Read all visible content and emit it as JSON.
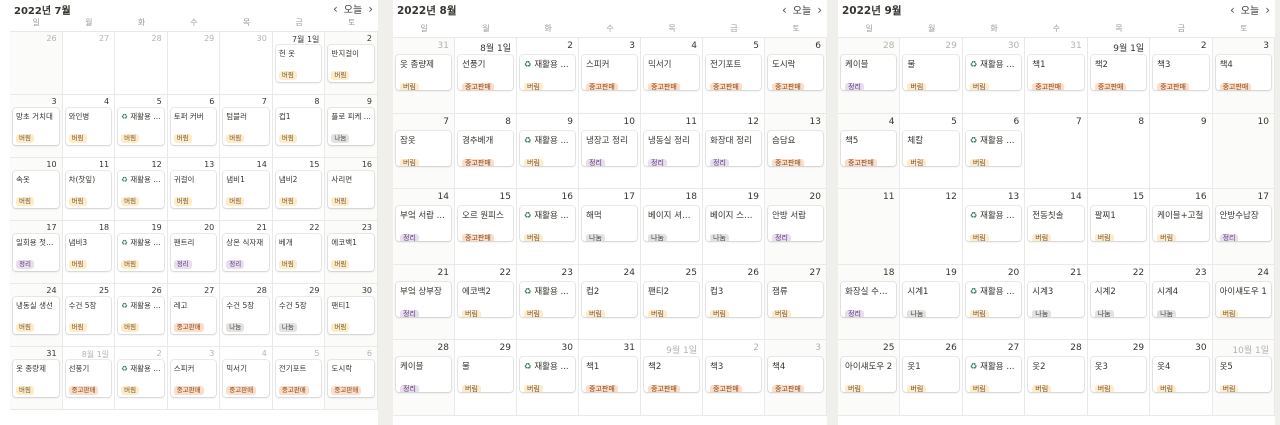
{
  "weekdays": [
    "일",
    "월",
    "화",
    "수",
    "목",
    "금",
    "토"
  ],
  "nav": {
    "prev": "‹",
    "today": "오늘",
    "next": "›"
  },
  "tags": {
    "b": "버림",
    "s": "중고판매",
    "j": "정리",
    "n": "나눔"
  },
  "calendars": [
    {
      "title": "2022년 7월",
      "cells": [
        {
          "d": "26",
          "dim": true
        },
        {
          "d": "27",
          "dim": true
        },
        {
          "d": "28",
          "dim": true
        },
        {
          "d": "29",
          "dim": true
        },
        {
          "d": "30",
          "dim": true
        },
        {
          "d": "7월 1일",
          "c": {
            "t": "헌 옷",
            "g": "b"
          }
        },
        {
          "d": "2",
          "c": {
            "t": "반지걸이",
            "g": "b"
          }
        },
        {
          "d": "3",
          "c": {
            "t": "망초 거치대",
            "g": "b"
          }
        },
        {
          "d": "4",
          "c": {
            "t": "와인병",
            "g": "b"
          }
        },
        {
          "d": "5",
          "c": {
            "t": "재활용 ...",
            "g": "b",
            "r": true
          }
        },
        {
          "d": "6",
          "c": {
            "t": "토퍼 커버",
            "g": "b"
          }
        },
        {
          "d": "7",
          "c": {
            "t": "텀블러",
            "g": "b"
          }
        },
        {
          "d": "8",
          "c": {
            "t": "컵1",
            "g": "b"
          }
        },
        {
          "d": "9",
          "c": {
            "t": "플로 피케 ...",
            "g": "n"
          }
        },
        {
          "d": "10",
          "c": {
            "t": "속옷",
            "g": "b"
          }
        },
        {
          "d": "11",
          "c": {
            "t": "차(찻잎)",
            "g": "b"
          }
        },
        {
          "d": "12",
          "c": {
            "t": "재활용 ...",
            "g": "b",
            "r": true
          }
        },
        {
          "d": "13",
          "c": {
            "t": "귀걸이",
            "g": "b"
          }
        },
        {
          "d": "14",
          "c": {
            "t": "냄비1",
            "g": "b"
          }
        },
        {
          "d": "15",
          "c": {
            "t": "냄비2",
            "g": "b"
          }
        },
        {
          "d": "16",
          "c": {
            "t": "사리면",
            "g": "b"
          }
        },
        {
          "d": "17",
          "c": {
            "t": "일회용 젓가락",
            "g": "j"
          }
        },
        {
          "d": "18",
          "c": {
            "t": "냄비3",
            "g": "b"
          }
        },
        {
          "d": "19",
          "c": {
            "t": "재활용 ...",
            "g": "b",
            "r": true
          }
        },
        {
          "d": "20",
          "c": {
            "t": "팬트리",
            "g": "j"
          }
        },
        {
          "d": "21",
          "c": {
            "t": "상온 식자재",
            "g": "j"
          }
        },
        {
          "d": "22",
          "c": {
            "t": "베개",
            "g": "b"
          }
        },
        {
          "d": "23",
          "c": {
            "t": "에코백1",
            "g": "b"
          }
        },
        {
          "d": "24",
          "c": {
            "t": "냉동실 생선",
            "g": "b"
          }
        },
        {
          "d": "25",
          "c": {
            "t": "수건 5장",
            "g": "b"
          }
        },
        {
          "d": "26",
          "c": {
            "t": "재활용 ...",
            "g": "b",
            "r": true
          }
        },
        {
          "d": "27",
          "c": {
            "t": "레고",
            "g": "s"
          }
        },
        {
          "d": "28",
          "c": {
            "t": "수건 5장",
            "g": "n"
          }
        },
        {
          "d": "29",
          "c": {
            "t": "수건 5장",
            "g": "n"
          }
        },
        {
          "d": "30",
          "c": {
            "t": "팬티1",
            "g": "b"
          }
        },
        {
          "d": "31",
          "c": {
            "t": "옷 종량제",
            "g": "b"
          }
        },
        {
          "d": "8월 1일",
          "dim": true,
          "c": {
            "t": "선풍기",
            "g": "s"
          }
        },
        {
          "d": "2",
          "dim": true,
          "c": {
            "t": "재활용 ...",
            "g": "b",
            "r": true
          }
        },
        {
          "d": "3",
          "dim": true,
          "c": {
            "t": "스피커",
            "g": "s"
          }
        },
        {
          "d": "4",
          "dim": true,
          "c": {
            "t": "믹서기",
            "g": "s"
          }
        },
        {
          "d": "5",
          "dim": true,
          "c": {
            "t": "전기포트",
            "g": "s"
          }
        },
        {
          "d": "6",
          "dim": true,
          "c": {
            "t": "도시락",
            "g": "s"
          }
        }
      ]
    },
    {
      "title": "2022년 8월",
      "cells": [
        {
          "d": "31",
          "dim": true,
          "c": {
            "t": "옷 종량제",
            "g": "b"
          }
        },
        {
          "d": "8월 1일",
          "c": {
            "t": "선풍기",
            "g": "s"
          }
        },
        {
          "d": "2",
          "c": {
            "t": "재활용 ...",
            "g": "b",
            "r": true
          }
        },
        {
          "d": "3",
          "c": {
            "t": "스피커",
            "g": "s"
          }
        },
        {
          "d": "4",
          "c": {
            "t": "믹서기",
            "g": "s"
          }
        },
        {
          "d": "5",
          "c": {
            "t": "전기포트",
            "g": "s"
          }
        },
        {
          "d": "6",
          "c": {
            "t": "도시락",
            "g": "s"
          }
        },
        {
          "d": "7",
          "c": {
            "t": "잠옷",
            "g": "b"
          }
        },
        {
          "d": "8",
          "c": {
            "t": "경추베개",
            "g": "s"
          }
        },
        {
          "d": "9",
          "c": {
            "t": "재활용 ...",
            "g": "b",
            "r": true
          }
        },
        {
          "d": "10",
          "c": {
            "t": "냉장고 정리",
            "g": "j"
          }
        },
        {
          "d": "11",
          "c": {
            "t": "냉동실 정리",
            "g": "j"
          }
        },
        {
          "d": "12",
          "c": {
            "t": "화장대 정리",
            "g": "j"
          }
        },
        {
          "d": "13",
          "c": {
            "t": "슴담요",
            "g": "s"
          }
        },
        {
          "d": "14",
          "c": {
            "t": "부엌 서랍 ...",
            "g": "j"
          }
        },
        {
          "d": "15",
          "c": {
            "t": "오르 원피스",
            "g": "s"
          }
        },
        {
          "d": "16",
          "c": {
            "t": "재활용 ...",
            "g": "b",
            "r": true
          }
        },
        {
          "d": "17",
          "c": {
            "t": "해먹",
            "g": "n"
          }
        },
        {
          "d": "18",
          "c": {
            "t": "베이지 셔틴...",
            "g": "n"
          }
        },
        {
          "d": "19",
          "c": {
            "t": "베이지 스커트",
            "g": "n"
          }
        },
        {
          "d": "20",
          "c": {
            "t": "안방 서랍",
            "g": "j"
          }
        },
        {
          "d": "21",
          "c": {
            "t": "부엌 상부장",
            "g": "j"
          }
        },
        {
          "d": "22",
          "c": {
            "t": "에코백2",
            "g": "b"
          }
        },
        {
          "d": "23",
          "c": {
            "t": "재활용 ...",
            "g": "b",
            "r": true
          }
        },
        {
          "d": "24",
          "c": {
            "t": "컵2",
            "g": "b"
          }
        },
        {
          "d": "25",
          "c": {
            "t": "팬티2",
            "g": "b"
          }
        },
        {
          "d": "26",
          "c": {
            "t": "컵3",
            "g": "b"
          }
        },
        {
          "d": "27",
          "c": {
            "t": "잼류",
            "g": "b"
          }
        },
        {
          "d": "28",
          "c": {
            "t": "케이블",
            "g": "j"
          }
        },
        {
          "d": "29",
          "c": {
            "t": "물",
            "g": "b"
          }
        },
        {
          "d": "30",
          "c": {
            "t": "재활용 ...",
            "g": "b",
            "r": true
          }
        },
        {
          "d": "31",
          "c": {
            "t": "책1",
            "g": "s"
          }
        },
        {
          "d": "9월 1일",
          "dim": true,
          "c": {
            "t": "책2",
            "g": "s"
          }
        },
        {
          "d": "2",
          "dim": true,
          "c": {
            "t": "책3",
            "g": "s"
          }
        },
        {
          "d": "3",
          "dim": true,
          "c": {
            "t": "책4",
            "g": "s"
          }
        }
      ]
    },
    {
      "title": "2022년 9월",
      "cells": [
        {
          "d": "28",
          "dim": true,
          "c": {
            "t": "케이블",
            "g": "j"
          }
        },
        {
          "d": "29",
          "dim": true,
          "c": {
            "t": "물",
            "g": "b"
          }
        },
        {
          "d": "30",
          "dim": true,
          "c": {
            "t": "재활용 ...",
            "g": "b",
            "r": true
          }
        },
        {
          "d": "31",
          "dim": true,
          "c": {
            "t": "책1",
            "g": "s"
          }
        },
        {
          "d": "9월 1일",
          "c": {
            "t": "책2",
            "g": "s"
          }
        },
        {
          "d": "2",
          "c": {
            "t": "책3",
            "g": "s"
          }
        },
        {
          "d": "3",
          "c": {
            "t": "책4",
            "g": "s"
          }
        },
        {
          "d": "4",
          "c": {
            "t": "책5",
            "g": "s"
          }
        },
        {
          "d": "5",
          "c": {
            "t": "체칼",
            "g": "b"
          }
        },
        {
          "d": "6",
          "c": {
            "t": "재활용 ...",
            "g": "b",
            "r": true
          }
        },
        {
          "d": "7"
        },
        {
          "d": "8"
        },
        {
          "d": "9"
        },
        {
          "d": "10"
        },
        {
          "d": "11"
        },
        {
          "d": "12"
        },
        {
          "d": "13",
          "c": {
            "t": "재활용 ...",
            "g": "b",
            "r": true
          }
        },
        {
          "d": "14",
          "c": {
            "t": "전동칫솔",
            "g": "b"
          }
        },
        {
          "d": "15",
          "c": {
            "t": "팔찌1",
            "g": "b"
          }
        },
        {
          "d": "16",
          "c": {
            "t": "케이블+고철",
            "g": "b"
          }
        },
        {
          "d": "17",
          "c": {
            "t": "안방수납장",
            "g": "j"
          }
        },
        {
          "d": "18",
          "c": {
            "t": "화장실 수납장",
            "g": "j"
          }
        },
        {
          "d": "19",
          "c": {
            "t": "시계1",
            "g": "n"
          }
        },
        {
          "d": "20",
          "c": {
            "t": "재활용 ...",
            "g": "b",
            "r": true
          }
        },
        {
          "d": "21",
          "c": {
            "t": "시계3",
            "g": "n"
          }
        },
        {
          "d": "22",
          "c": {
            "t": "시계2",
            "g": "n"
          }
        },
        {
          "d": "23",
          "c": {
            "t": "시계4",
            "g": "n"
          }
        },
        {
          "d": "24",
          "c": {
            "t": "아이섀도우 1",
            "g": "b"
          }
        },
        {
          "d": "25",
          "c": {
            "t": "아이섀도우 2",
            "g": "b"
          }
        },
        {
          "d": "26",
          "c": {
            "t": "옷1",
            "g": "b"
          }
        },
        {
          "d": "27",
          "c": {
            "t": "재활용 ...",
            "g": "b",
            "r": true
          }
        },
        {
          "d": "28",
          "c": {
            "t": "옷2",
            "g": "b"
          }
        },
        {
          "d": "29",
          "c": {
            "t": "옷3",
            "g": "b"
          }
        },
        {
          "d": "30",
          "c": {
            "t": "옷4",
            "g": "b"
          }
        },
        {
          "d": "10월 1일",
          "dim": true,
          "c": {
            "t": "옷5",
            "g": "b"
          }
        }
      ]
    }
  ]
}
